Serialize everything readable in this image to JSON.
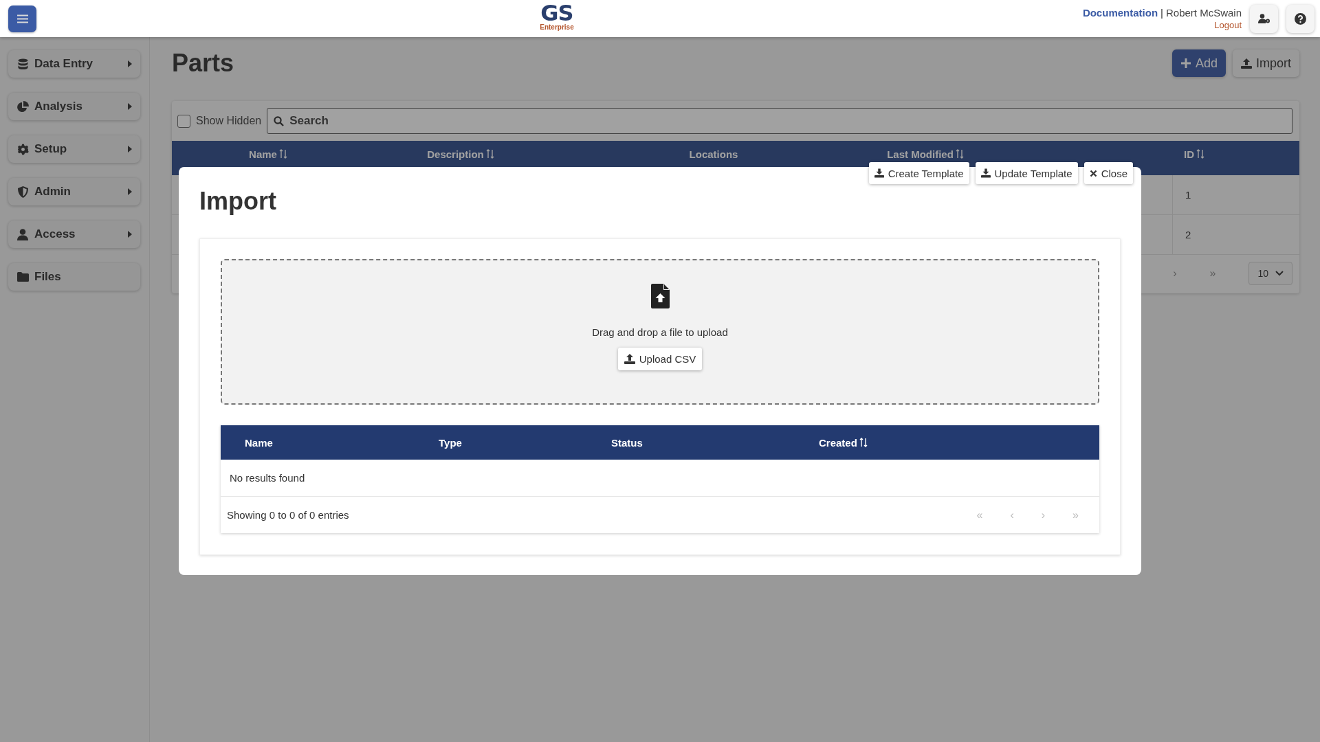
{
  "header": {
    "logo_title": "GS",
    "logo_subtitle": "Enterprise",
    "documentation_link": "Documentation",
    "separator": "|",
    "user_name": "Robert McSwain",
    "logout_link": "Logout"
  },
  "sidebar": {
    "items": [
      {
        "label": "Data Entry",
        "has_submenu": true
      },
      {
        "label": "Analysis",
        "has_submenu": true
      },
      {
        "label": "Setup",
        "has_submenu": true
      },
      {
        "label": "Admin",
        "has_submenu": true
      },
      {
        "label": "Access",
        "has_submenu": true
      },
      {
        "label": "Files",
        "has_submenu": false
      }
    ]
  },
  "page": {
    "title": "Parts",
    "buttons": [
      {
        "label": "Add",
        "kind": "primary"
      },
      {
        "label": "Import",
        "kind": "secondary"
      }
    ],
    "show_hidden": {
      "label": "Show Hidden",
      "checked": false
    },
    "search": {
      "placeholder": "Search"
    },
    "table": {
      "columns": [
        {
          "label": "Name",
          "sortable": true
        },
        {
          "label": "Description",
          "sortable": true
        },
        {
          "label": "Locations",
          "sortable": false
        },
        {
          "label": "Last Modified",
          "sortable": true
        },
        {
          "label": "ID",
          "sortable": true
        }
      ],
      "rows": [
        {
          "id": "1"
        },
        {
          "id": "2"
        }
      ],
      "pager": [
        "›",
        "»"
      ],
      "page_size": "10"
    }
  },
  "modal": {
    "title": "Import",
    "actions": [
      {
        "label": "Create Template"
      },
      {
        "label": "Update Template"
      },
      {
        "label": "Close"
      }
    ],
    "dropzone": {
      "text": "Drag and drop a file to upload",
      "button": "Upload CSV"
    },
    "table": {
      "columns": [
        {
          "label": "Name",
          "sortable": false
        },
        {
          "label": "Type",
          "sortable": false
        },
        {
          "label": "Status",
          "sortable": false
        },
        {
          "label": "Created",
          "sortable": true
        }
      ],
      "empty_text": "No results found",
      "summary": "Showing 0 to 0 of 0 entries",
      "pager": [
        "«",
        "‹",
        "›",
        "»"
      ]
    }
  }
}
